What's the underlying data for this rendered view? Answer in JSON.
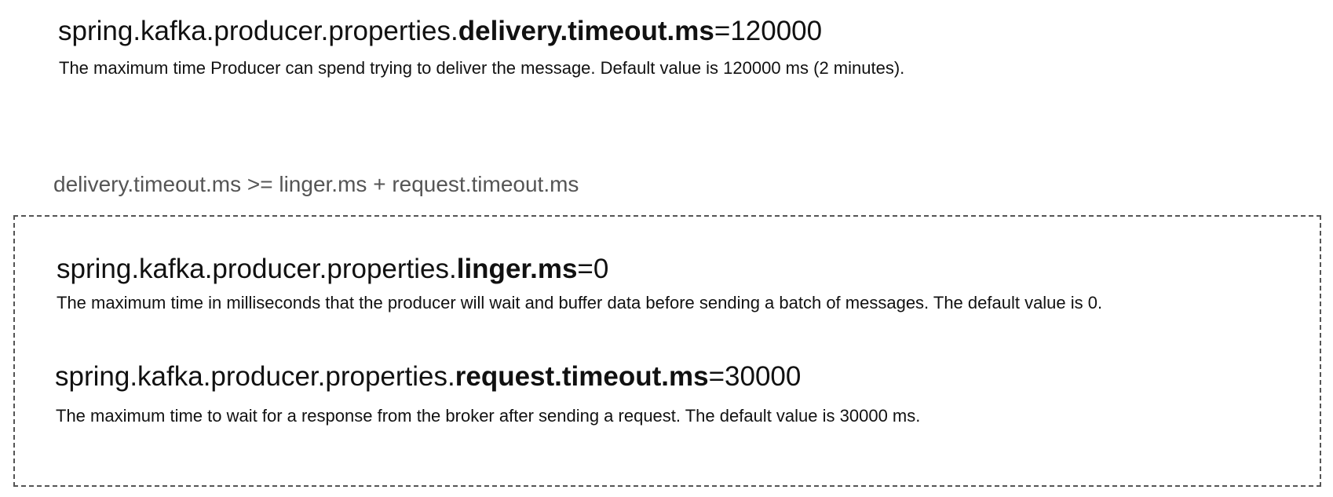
{
  "delivery": {
    "prefix": "spring.kafka.producer.properties.",
    "key": "delivery.timeout.ms",
    "value": "=120000",
    "description": "The maximum time Producer can spend trying to deliver the message. Default value is 120000 ms (2 minutes)."
  },
  "relation": "delivery.timeout.ms >=  linger.ms + request.timeout.ms",
  "linger": {
    "prefix": "spring.kafka.producer.properties.",
    "key": "linger.ms",
    "value": "=0",
    "description": "The maximum time in milliseconds that the producer will wait and buffer data before sending a batch of messages. The default value is 0."
  },
  "request": {
    "prefix": "spring.kafka.producer.properties.",
    "key": "request.timeout.ms",
    "value": "=30000",
    "description": "The maximum time to wait for a response from the broker after sending a request. The default value is 30000 ms."
  },
  "colors": {
    "text": "#111111",
    "relation_text": "#555555",
    "dashed_border": "#555555",
    "background": "#ffffff"
  }
}
